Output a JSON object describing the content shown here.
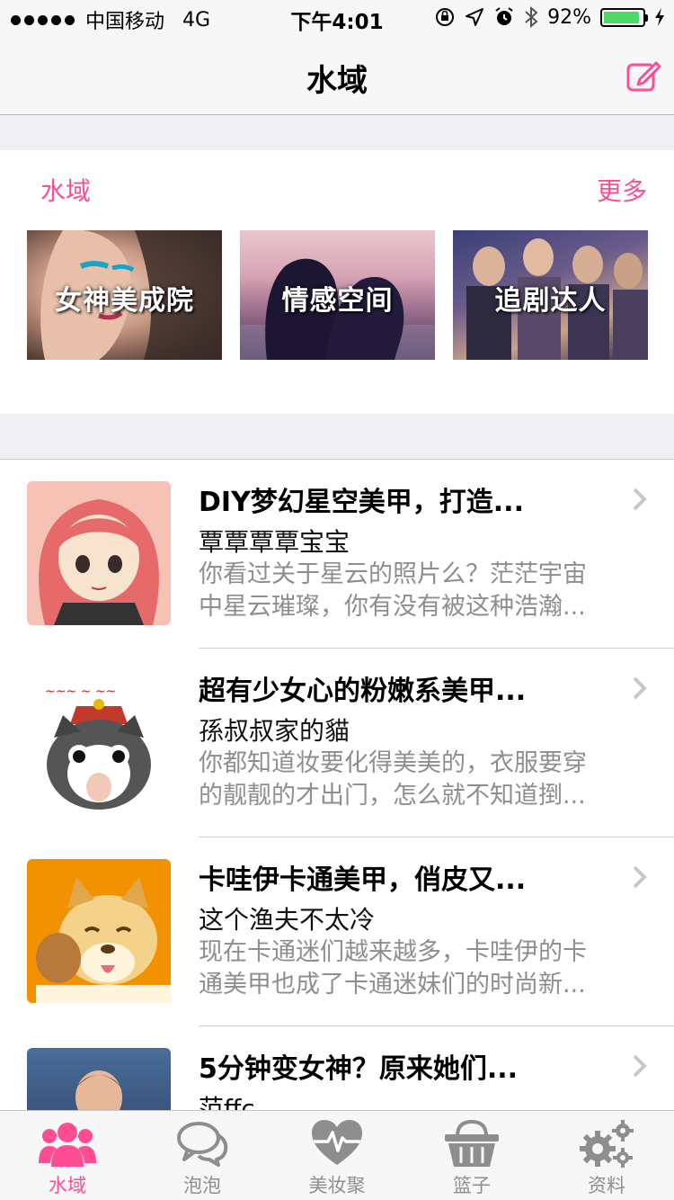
{
  "status_bar": {
    "carrier": "中国移动",
    "network": "4G",
    "time": "下午4:01",
    "battery": "92%",
    "battery_level": 0.92
  },
  "nav": {
    "title": "水域",
    "edit_icon": "compose-icon"
  },
  "category_section": {
    "title": "水域",
    "more_label": "更多",
    "cards": [
      {
        "label": "女神美成院"
      },
      {
        "label": "情感空间"
      },
      {
        "label": "追剧达人"
      }
    ]
  },
  "articles": [
    {
      "title": "DIY梦幻星空美甲，打造...",
      "author": "覃覃覃覃宝宝",
      "summary_line1": "你看过关于星云的照片么？茫茫宇宙",
      "summary_line2": "中星云璀璨，你有没有被这种浩瀚..."
    },
    {
      "title": "超有少女心的粉嫩系美甲...",
      "author": "孫叔叔家的貓",
      "summary_line1": "你都知道妆要化得美美的，衣服要穿",
      "summary_line2": "的靓靓的才出门，怎么就不知道捯..."
    },
    {
      "title": "卡哇伊卡通美甲，俏皮又...",
      "author": "这个渔夫不太冷",
      "summary_line1": "现在卡通迷们越来越多，卡哇伊的卡",
      "summary_line2": "通美甲也成了卡通迷妹们的时尚新..."
    },
    {
      "title": "5分钟变女神？原来她们...",
      "author": "范ffc",
      "summary_line1": "",
      "summary_line2": ""
    }
  ],
  "tab_bar": {
    "tabs": [
      {
        "label": "水域",
        "icon": "people-icon",
        "active": true
      },
      {
        "label": "泡泡",
        "icon": "chat-bubbles-icon",
        "active": false
      },
      {
        "label": "美妆聚",
        "icon": "heart-pulse-icon",
        "active": false
      },
      {
        "label": "篮子",
        "icon": "basket-icon",
        "active": false
      },
      {
        "label": "资料",
        "icon": "gears-icon",
        "active": false
      }
    ]
  },
  "colors": {
    "accent": "#ff4d94",
    "inactive": "#8e8e8e",
    "battery": "#4cd964"
  }
}
